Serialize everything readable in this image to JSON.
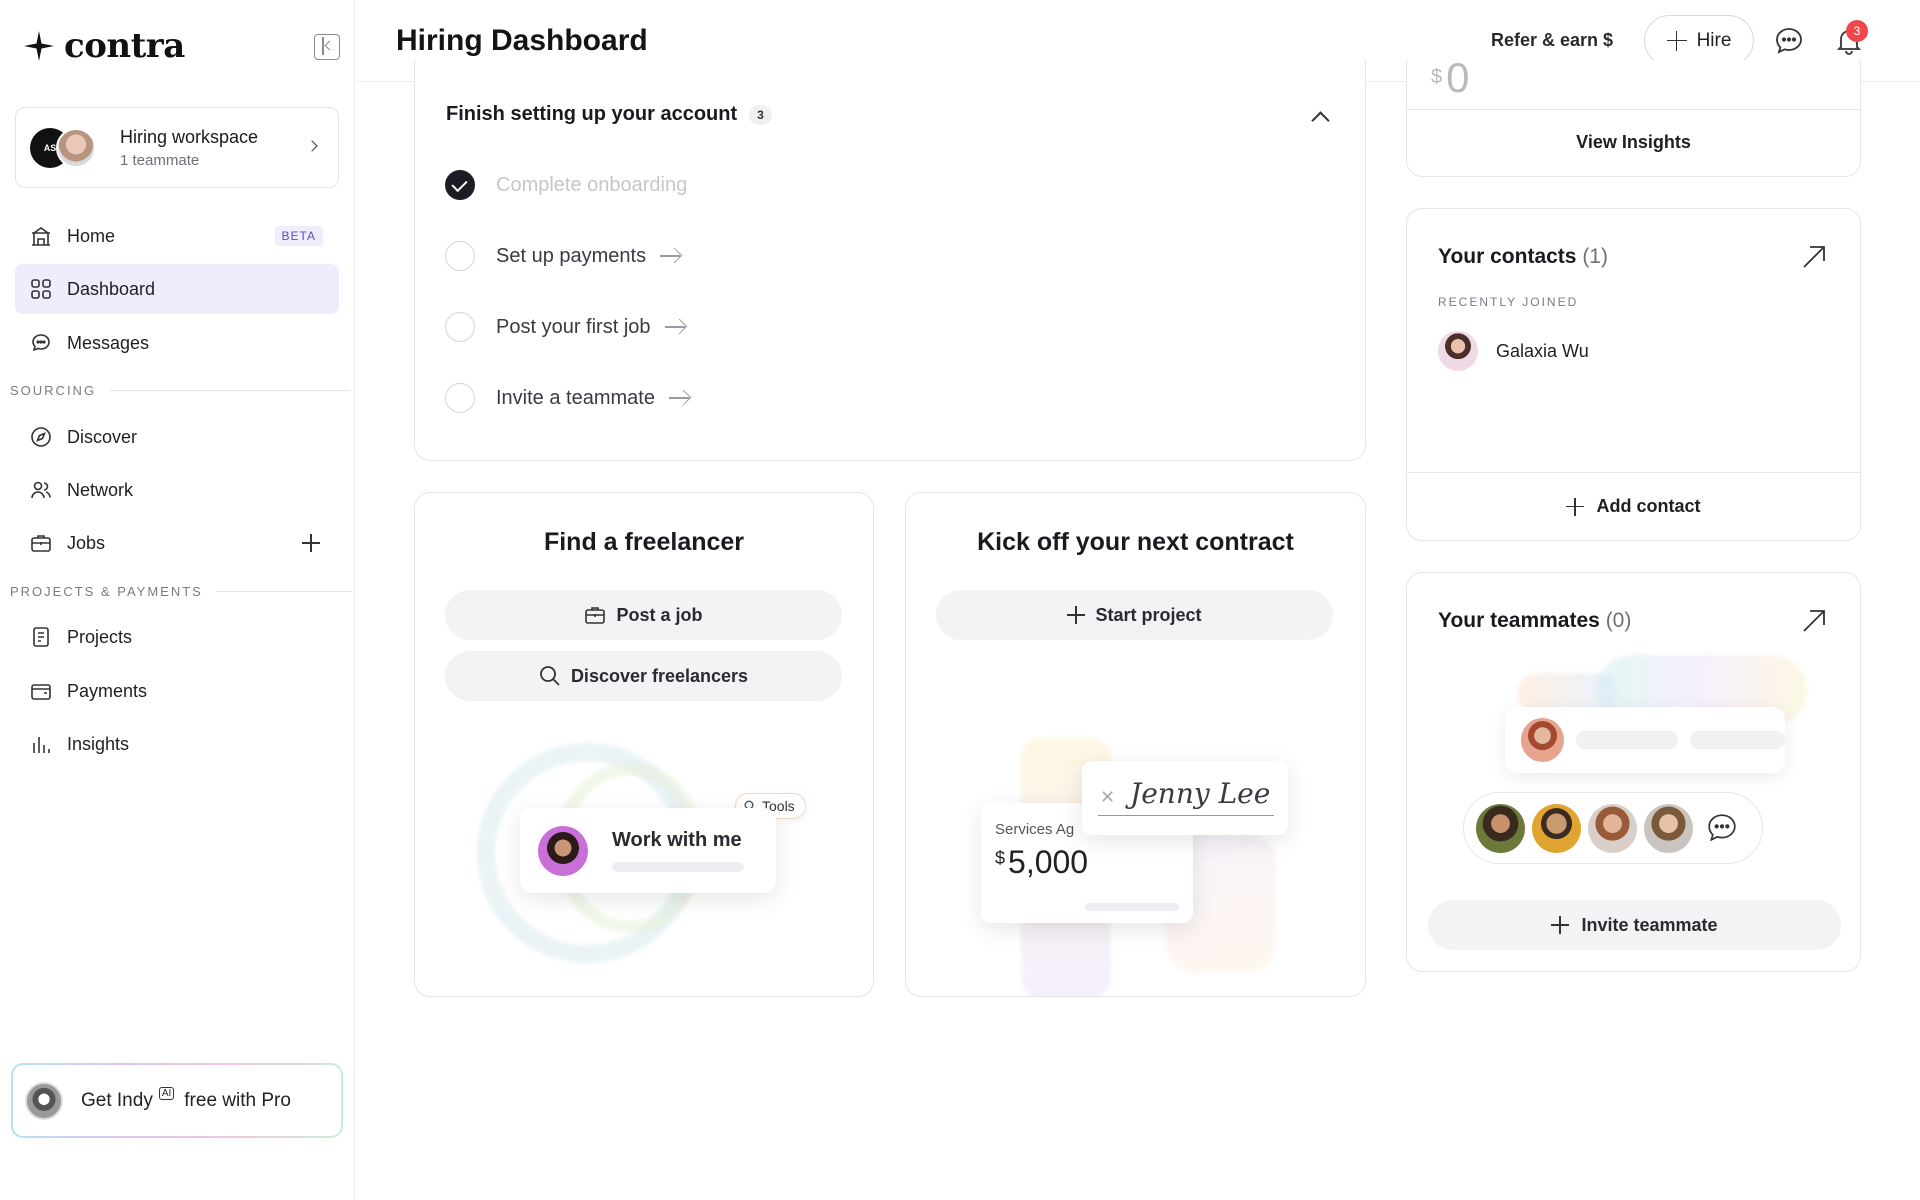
{
  "brand": {
    "name": "contra"
  },
  "workspace": {
    "name": "Hiring workspace",
    "subtitle": "1 teammate",
    "logo_text": "AS"
  },
  "nav": {
    "home": "Home",
    "home_badge": "BETA",
    "dashboard": "Dashboard",
    "messages": "Messages",
    "sourcing_label": "SOURCING",
    "discover": "Discover",
    "network": "Network",
    "jobs": "Jobs",
    "projects_label": "PROJECTS & PAYMENTS",
    "projects": "Projects",
    "payments": "Payments",
    "insights": "Insights",
    "active": "Dashboard"
  },
  "promo": {
    "prefix": "Get Indy",
    "ai_tag": "AI",
    "suffix": "free with Pro"
  },
  "header": {
    "title": "Hiring Dashboard",
    "refer": "Refer & earn $",
    "hire": "Hire",
    "notification_count": "3"
  },
  "setup": {
    "title": "Finish setting up your account",
    "count": "3",
    "tasks": [
      {
        "label": "Complete onboarding",
        "done": true
      },
      {
        "label": "Set up payments",
        "done": false
      },
      {
        "label": "Post your first job",
        "done": false
      },
      {
        "label": "Invite a teammate",
        "done": false
      }
    ]
  },
  "freelancer": {
    "title": "Find a freelancer",
    "post_job": "Post a job",
    "discover": "Discover freelancers",
    "illustration": {
      "card_title": "Work with me",
      "chip": "Tools"
    }
  },
  "contract": {
    "title": "Kick off your next contract",
    "start_project": "Start project",
    "illustration": {
      "services_label": "Services Ag",
      "currency": "$",
      "amount": "5,000",
      "signature": "Jenny Lee"
    }
  },
  "insights_card": {
    "currency": "$",
    "value": "0",
    "view_insights": "View Insights"
  },
  "contacts": {
    "title": "Your contacts",
    "count": "(1)",
    "recent_label": "RECENTLY JOINED",
    "recent_contact": "Galaxia Wu",
    "add_contact": "Add contact"
  },
  "teammates": {
    "title": "Your teammates",
    "count": "(0)",
    "invite": "Invite teammate"
  },
  "colors": {
    "accent_bg": "#efecfc",
    "accent_text": "#5d4fc4",
    "notification": "#f0484a",
    "border": "#e6e6ea"
  }
}
